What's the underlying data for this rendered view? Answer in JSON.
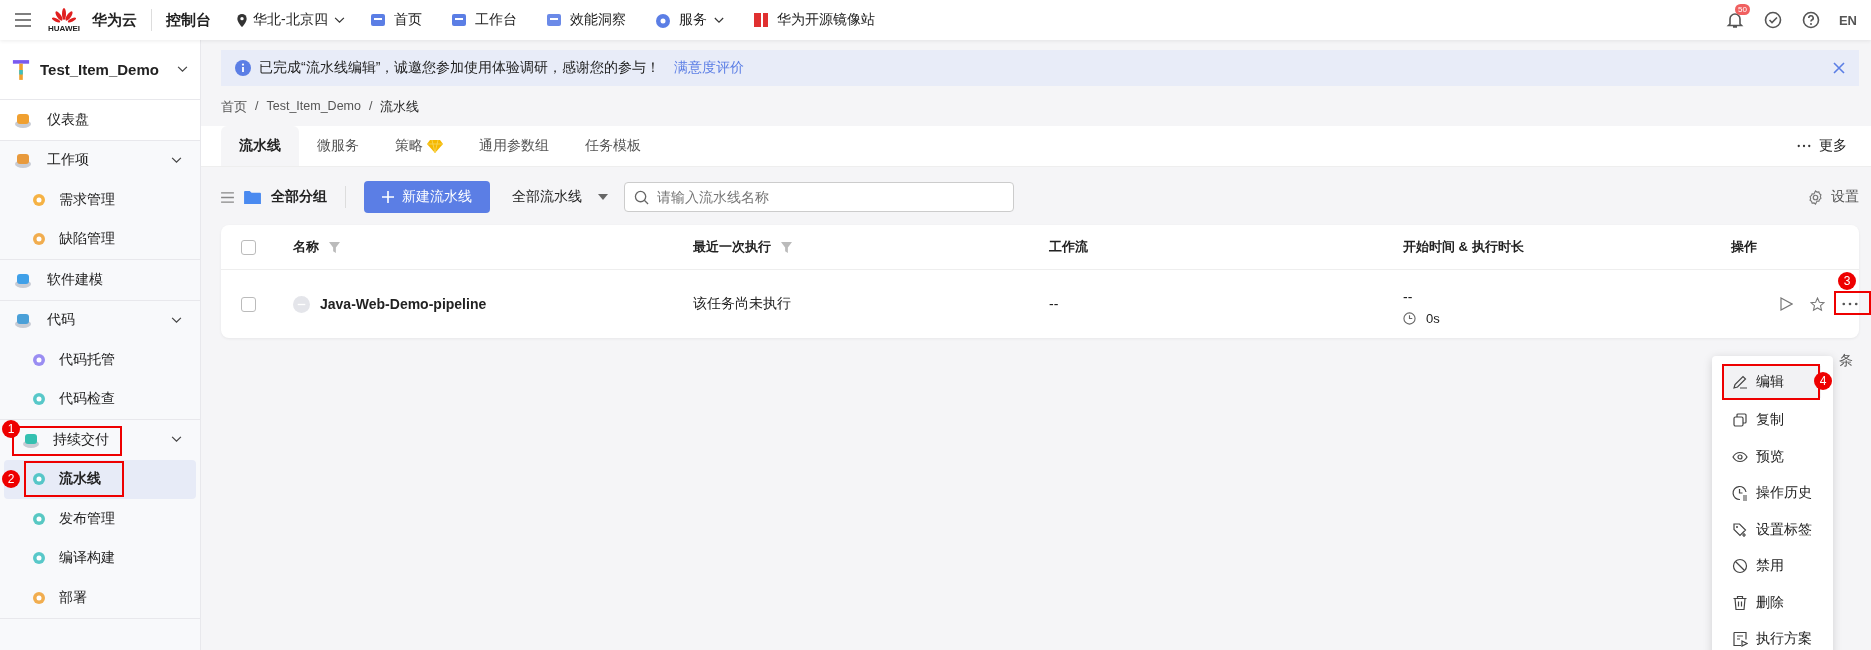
{
  "topbar": {
    "logo_text": "HUAWEI",
    "brand": "华为云",
    "console": "控制台",
    "region": "华北-北京四",
    "nav": [
      {
        "label": "首页",
        "dropdown": false
      },
      {
        "label": "工作台",
        "dropdown": false
      },
      {
        "label": "效能洞察",
        "dropdown": false
      },
      {
        "label": "服务",
        "dropdown": true
      },
      {
        "label": "华为开源镜像站",
        "dropdown": false
      }
    ],
    "notification_count": "50",
    "language": "EN"
  },
  "sidebar": {
    "project": "Test_Item_Demo",
    "items": [
      {
        "label": "仪表盘",
        "selected": false
      },
      {
        "label": "工作项",
        "expanded": true,
        "selected": false,
        "children": [
          {
            "label": "需求管理",
            "selected": false
          },
          {
            "label": "缺陷管理",
            "selected": false
          }
        ]
      },
      {
        "label": "软件建模",
        "selected": false
      },
      {
        "label": "代码",
        "expanded": true,
        "selected": false,
        "children": [
          {
            "label": "代码托管",
            "selected": false
          },
          {
            "label": "代码检查",
            "selected": false
          }
        ]
      },
      {
        "label": "持续交付",
        "expanded": true,
        "selected": false,
        "marker": "1",
        "children": [
          {
            "label": "流水线",
            "selected": true,
            "marker": "2"
          },
          {
            "label": "发布管理",
            "selected": false
          },
          {
            "label": "编译构建",
            "selected": false
          },
          {
            "label": "部署",
            "selected": false
          }
        ]
      }
    ]
  },
  "banner": {
    "text": "已完成“流水线编辑”，诚邀您参加使用体验调研，感谢您的参与！",
    "link": "满意度评价"
  },
  "breadcrumb": {
    "separator": "/",
    "items": [
      "首页",
      "Test_Item_Demo",
      "流水线"
    ]
  },
  "tabs": [
    {
      "label": "流水线",
      "selected": true
    },
    {
      "label": "微服务",
      "selected": false
    },
    {
      "label": "策略",
      "selected": false,
      "badge": true
    },
    {
      "label": "通用参数组",
      "selected": false
    },
    {
      "label": "任务模板",
      "selected": false
    }
  ],
  "more_tabs": "更多",
  "toolbar": {
    "group": "全部分组",
    "new_button": "新建流水线",
    "filter": "全部流水线",
    "search": {
      "placeholder": "请输入流水线名称"
    },
    "settings": "设置"
  },
  "table": {
    "all_checked": false,
    "columns": [
      {
        "label": "名称",
        "filter": true
      },
      {
        "label": "最近一次执行",
        "filter": true
      },
      {
        "label": "工作流",
        "filter": false
      },
      {
        "label": "开始时间 & 执行时长",
        "filter": false
      },
      {
        "label": "操作",
        "filter": false
      }
    ],
    "rows": [
      {
        "checked": false,
        "name": "Java-Web-Demo-pipeline",
        "last_run": "该任务尚未执行",
        "workflow": "--",
        "start_time": "--",
        "duration": "0s",
        "more_marker": "3"
      }
    ]
  },
  "pagination_fragment": "条",
  "menu": [
    {
      "label": "编辑",
      "selected": true,
      "marker": "4"
    },
    {
      "label": "复制",
      "selected": false
    },
    {
      "label": "预览",
      "selected": false
    },
    {
      "label": "操作历史",
      "selected": false
    },
    {
      "label": "设置标签",
      "selected": false
    },
    {
      "label": "禁用",
      "selected": false
    },
    {
      "label": "删除",
      "selected": false
    },
    {
      "label": "执行方案",
      "selected": false
    }
  ]
}
